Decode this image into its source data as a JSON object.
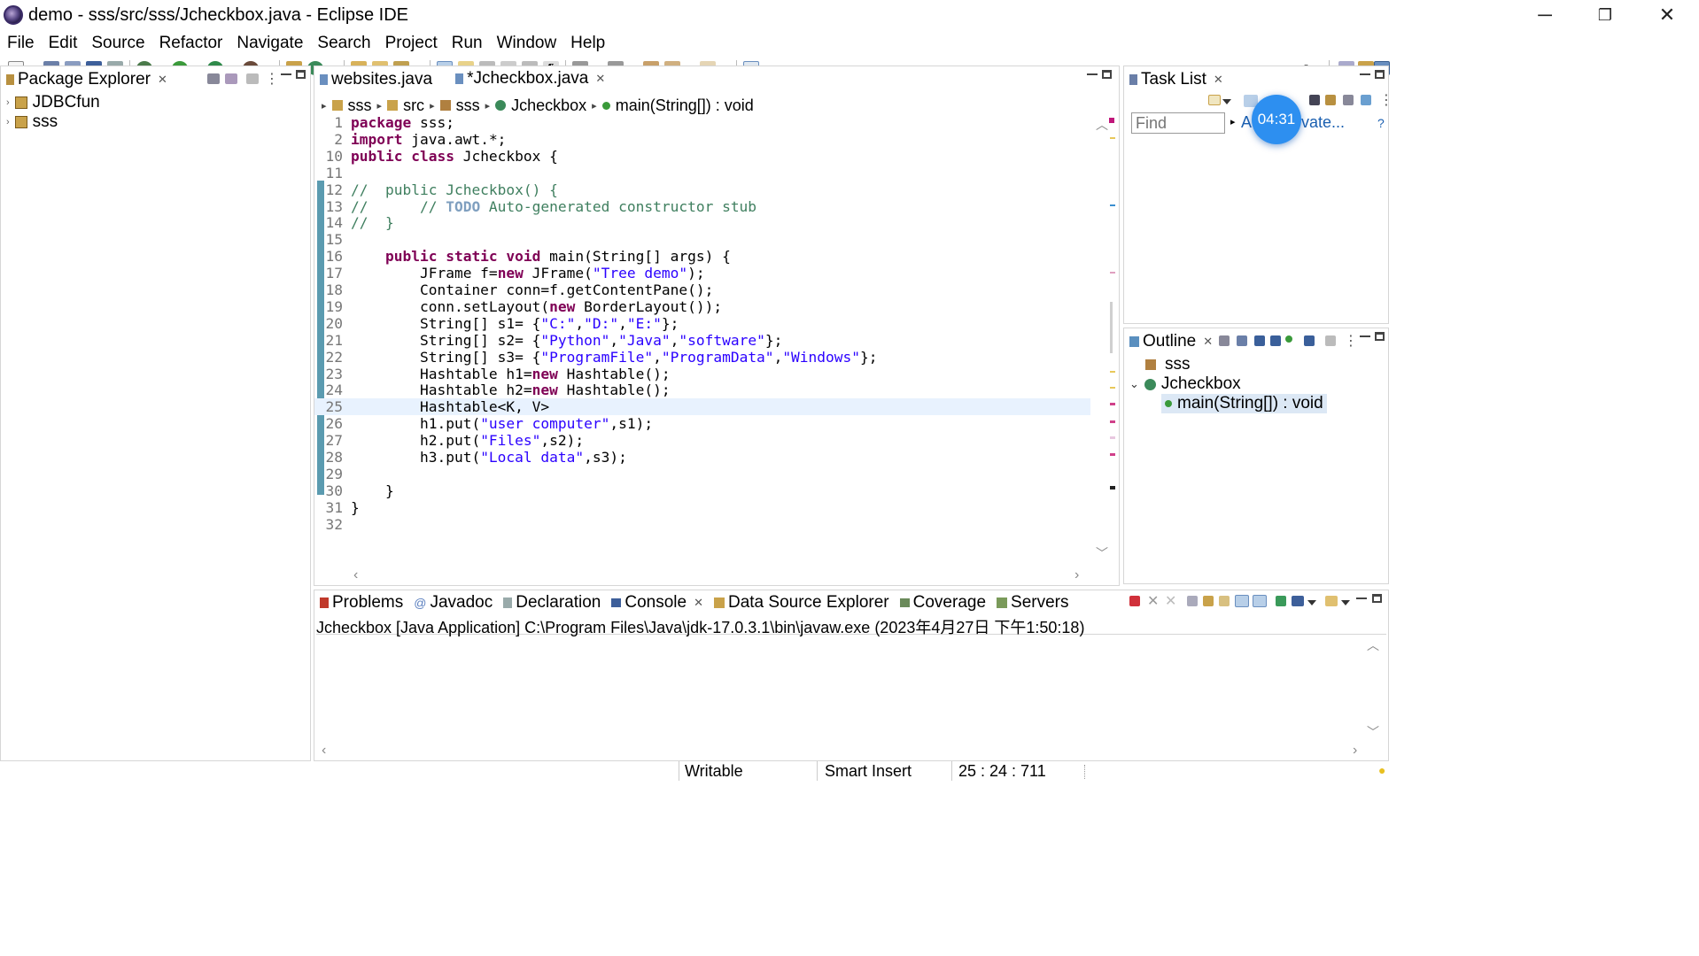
{
  "window": {
    "title": "demo - sss/src/sss/Jcheckbox.java - Eclipse IDE",
    "minimize_glyph": "─",
    "restore_glyph": "❐",
    "close_glyph": "✕"
  },
  "menu": [
    "File",
    "Edit",
    "Source",
    "Refactor",
    "Navigate",
    "Search",
    "Project",
    "Run",
    "Window",
    "Help"
  ],
  "package_explorer": {
    "title": "Package Explorer",
    "items": [
      {
        "label": "JDBCfun",
        "icon": "java-project-icon"
      },
      {
        "label": "sss",
        "icon": "java-project-icon"
      }
    ]
  },
  "editor": {
    "tabs": [
      {
        "label": "websites.java",
        "active": false
      },
      {
        "label": "*Jcheckbox.java",
        "active": true
      }
    ],
    "breadcrumb": [
      "sss",
      "src",
      "sss",
      "Jcheckbox",
      "main(String[]) : void"
    ],
    "lines": [
      {
        "n": "1",
        "html": "<span class='kw'>package</span> sss;"
      },
      {
        "n": "2",
        "html": "<span class='kw'>import</span> java.awt.*;"
      },
      {
        "n": "10",
        "html": "<span class='kw'>public class</span> Jcheckbox {"
      },
      {
        "n": "11",
        "html": ""
      },
      {
        "n": "12",
        "html": "<span class='cmt'>//  public Jcheckbox() {</span>"
      },
      {
        "n": "13",
        "html": "<span class='cmt'>//      // <span class='todo'>TODO</span> Auto-generated constructor stub</span>"
      },
      {
        "n": "14",
        "html": "<span class='cmt'>//  }</span>"
      },
      {
        "n": "15",
        "html": ""
      },
      {
        "n": "16",
        "html": "    <span class='kw'>public static void</span> main(String[] args) {"
      },
      {
        "n": "17",
        "html": "        JFrame f=<span class='kw'>new</span> JFrame(<span class='str'>\"Tree demo\"</span>);"
      },
      {
        "n": "18",
        "html": "        Container conn=f.getContentPane();"
      },
      {
        "n": "19",
        "html": "        conn.setLayout(<span class='kw'>new</span> BorderLayout());"
      },
      {
        "n": "20",
        "html": "        String[] s1= {<span class='str'>\"C:\"</span>,<span class='str'>\"D:\"</span>,<span class='str'>\"E:\"</span>};"
      },
      {
        "n": "21",
        "html": "        String[] s2= {<span class='str'>\"Python\"</span>,<span class='str'>\"Java\"</span>,<span class='str'>\"software\"</span>};"
      },
      {
        "n": "22",
        "html": "        String[] s3= {<span class='str'>\"ProgramFile\"</span>,<span class='str'>\"ProgramData\"</span>,<span class='str'>\"Windows\"</span>};"
      },
      {
        "n": "23",
        "html": "        Hashtable h1=<span class='kw'>new</span> Hashtable();"
      },
      {
        "n": "24",
        "html": "        Hashtable h2=<span class='kw'>new</span> Hashtable();"
      },
      {
        "n": "25",
        "html": "        Hashtable&lt;K, V&gt;"
      },
      {
        "n": "26",
        "html": "        h1.put(<span class='str'>\"user computer\"</span>,s1);"
      },
      {
        "n": "27",
        "html": "        h2.put(<span class='str'>\"Files\"</span>,s2);"
      },
      {
        "n": "28",
        "html": "        h3.put(<span class='str'>\"Local data\"</span>,s3);"
      },
      {
        "n": "29",
        "html": ""
      },
      {
        "n": "30",
        "html": "    }"
      },
      {
        "n": "31",
        "html": "}"
      },
      {
        "n": "32",
        "html": ""
      }
    ]
  },
  "task_list": {
    "title": "Task List",
    "find_placeholder": "Find",
    "all_label": "A",
    "activate_label": "vate...",
    "timer": "04:31"
  },
  "outline": {
    "title": "Outline",
    "items": [
      {
        "label": "sss",
        "level": 0
      },
      {
        "label": "Jcheckbox",
        "level": 0
      },
      {
        "label": "main(String[]) : void",
        "level": 1
      }
    ]
  },
  "bottom": {
    "tabs": [
      "Problems",
      "Javadoc",
      "Declaration",
      "Console",
      "Data Source Explorer",
      "Coverage",
      "Servers"
    ],
    "active_tab": "Console",
    "console_header": "Jcheckbox [Java Application] C:\\Program Files\\Java\\jdk-17.0.3.1\\bin\\javaw.exe  (2023年4月27日 下午1:50:18)"
  },
  "status": {
    "writable": "Writable",
    "insert_mode": "Smart Insert",
    "position": "25 : 24 : 711"
  },
  "colors": {
    "keyword": "#7f0055",
    "string": "#2a00ff",
    "comment": "#3f7f5f",
    "timer_bg": "#2d8ff0"
  }
}
